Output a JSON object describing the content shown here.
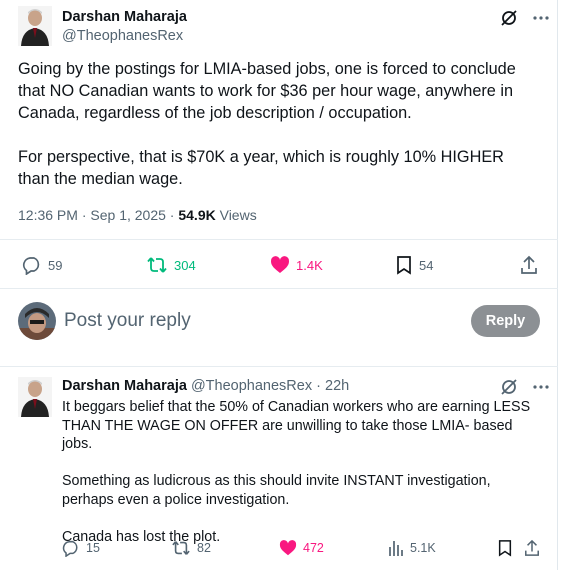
{
  "post": {
    "author_name": "Darshan Maharaja",
    "author_handle": "@TheophanesRex",
    "paragraphs": [
      "Going by the postings for LMIA-based jobs, one is forced to conclude that NO Canadian wants to work for $36 per hour wage, anywhere in Canada, regardless of the job description / occupation.",
      "For perspective, that is $70K a year, which is roughly 10% HIGHER than the median wage."
    ],
    "time": "12:36 PM",
    "separator": "·",
    "date": "Sep 1, 2025",
    "views_count": "54.9K",
    "views_label": "Views",
    "replies": "59",
    "reposts": "304",
    "likes": "1.4K",
    "bookmarks": "54"
  },
  "reply_box": {
    "placeholder": "Post your reply",
    "button_label": "Reply"
  },
  "reply": {
    "author_name": "Darshan Maharaja",
    "author_handle": "@TheophanesRex",
    "dot": "·",
    "age": "22h",
    "paragraphs": [
      "It beggars belief that the 50% of Canadian workers who are earning LESS THAN THE WAGE ON OFFER are unwilling to take those LMIA- based jobs.",
      "Something as ludicrous as this should invite INSTANT investigation, perhaps even a police investigation.",
      "Canada has lost the plot."
    ],
    "replies": "15",
    "reposts": "82",
    "likes": "472",
    "views": "5.1K"
  },
  "colors": {
    "repost_green": "#00ba7c",
    "like_pink": "#f91880",
    "muted": "#536471",
    "reply_button_bg": "#8c9094"
  }
}
